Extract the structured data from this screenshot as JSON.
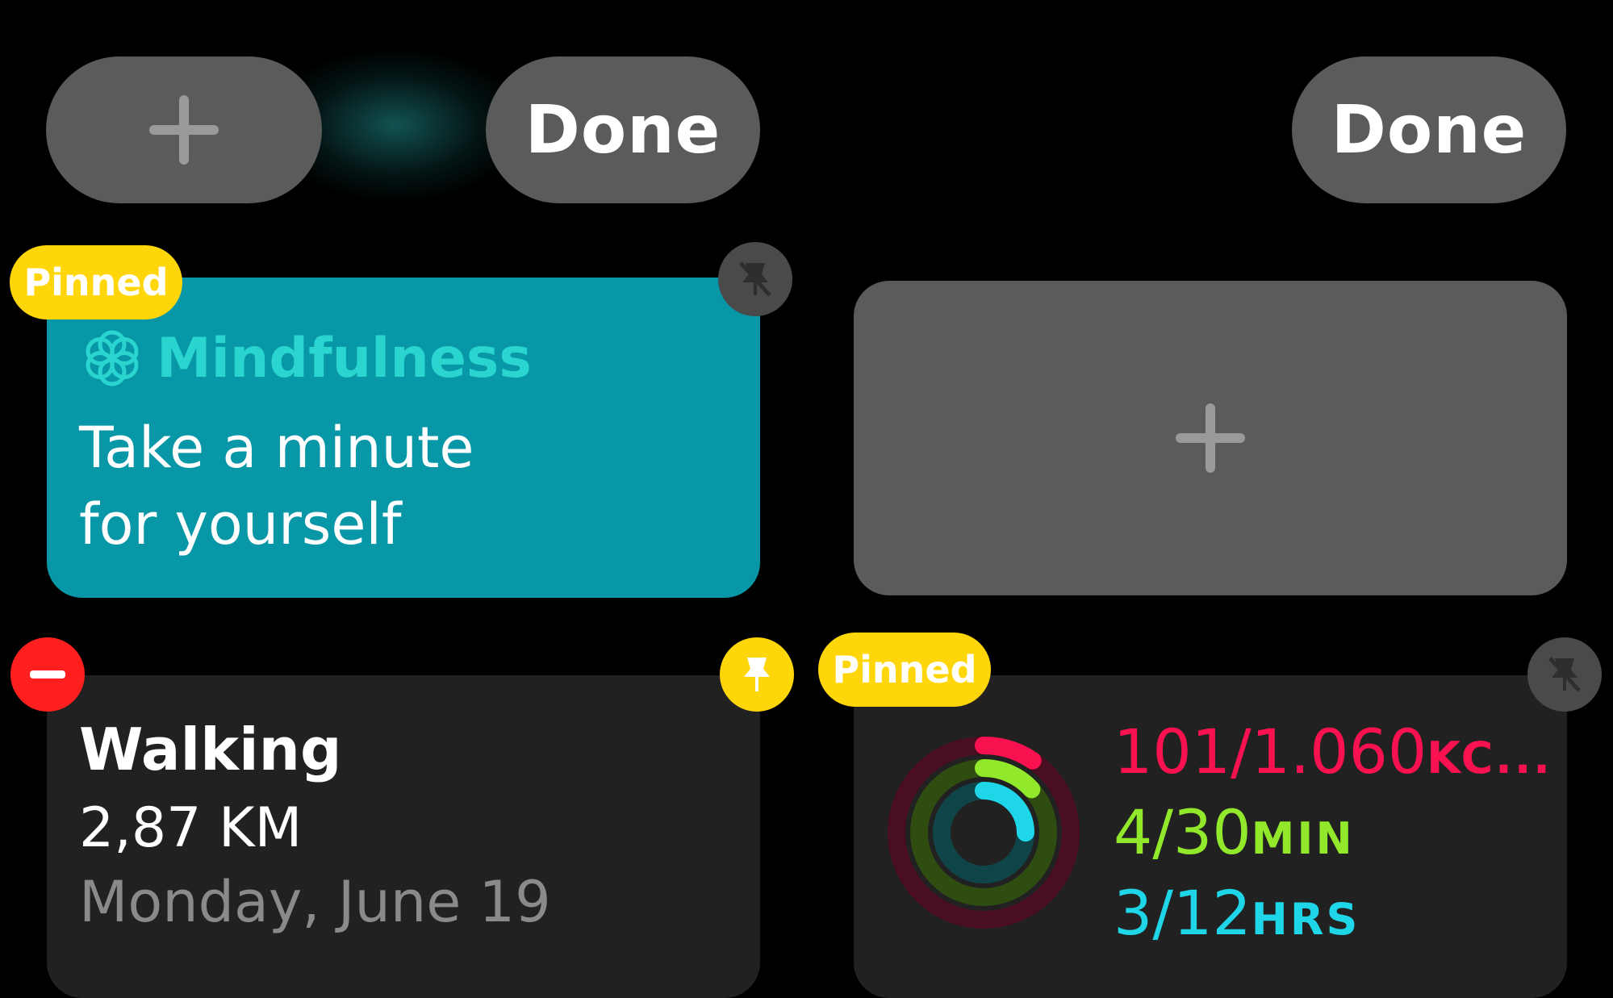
{
  "top_bar": {
    "left_done_label": "Done",
    "right_done_label": "Done",
    "add_icon": "plus-icon"
  },
  "widgets": {
    "mindfulness": {
      "badge": "Pinned",
      "title": "Mindfulness",
      "message": [
        "Take a minute",
        "for yourself"
      ],
      "icon": "flower-icon",
      "unpin_icon": "unpin-icon",
      "color": "#0797a6"
    },
    "empty_slot": {
      "icon": "plus-icon"
    },
    "walking": {
      "title": "Walking",
      "distance": "2,87 KM",
      "date": "Monday, June 19",
      "remove_icon": "minus-icon",
      "pin_icon": "pin-icon"
    },
    "activity": {
      "badge": "Pinned",
      "move": {
        "value": "101/1.060",
        "unit": "KC...",
        "color": "#fa114f"
      },
      "exercise": {
        "value": "4/30",
        "unit": "MIN",
        "color": "#92e82a"
      },
      "stand": {
        "value": "3/12",
        "unit": "HRS",
        "color": "#1ed6e8"
      },
      "rings": {
        "move_fraction": 0.095,
        "exercise_fraction": 0.133,
        "stand_fraction": 0.25
      },
      "unpin_icon": "unpin-icon"
    }
  },
  "colors": {
    "badge_yellow": "#ffd60a",
    "remove_red": "#ff1f1f",
    "button_gray": "#5b5b5b"
  }
}
